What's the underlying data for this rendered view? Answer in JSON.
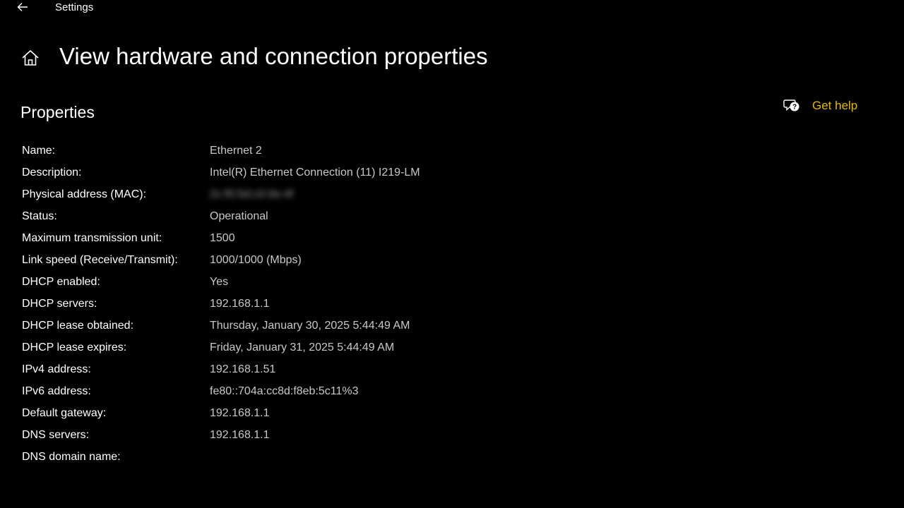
{
  "titlebar": {
    "app_title": "Settings"
  },
  "header": {
    "title": "View hardware and connection properties"
  },
  "section": {
    "title": "Properties"
  },
  "help": {
    "label": "Get help"
  },
  "colors": {
    "background": "#000000",
    "text": "#ffffff",
    "value_text": "#c8c8c8",
    "accent_link": "#e6b800"
  },
  "properties": [
    {
      "label": "Name:",
      "value": "Ethernet 2"
    },
    {
      "label": "Description:",
      "value": "Intel(R) Ethernet Connection (11) I219-LM"
    },
    {
      "label": "Physical address (MAC):",
      "value": "2c:f0:5d:c0:9e:4f"
    },
    {
      "label": "Status:",
      "value": "Operational"
    },
    {
      "label": "Maximum transmission unit:",
      "value": "1500"
    },
    {
      "label": "Link speed (Receive/Transmit):",
      "value": "1000/1000 (Mbps)"
    },
    {
      "label": "DHCP enabled:",
      "value": "Yes"
    },
    {
      "label": "DHCP servers:",
      "value": "192.168.1.1"
    },
    {
      "label": "DHCP lease obtained:",
      "value": "Thursday, January 30, 2025 5:44:49 AM"
    },
    {
      "label": "DHCP lease expires:",
      "value": "Friday, January 31, 2025 5:44:49 AM"
    },
    {
      "label": "IPv4 address:",
      "value": "192.168.1.51"
    },
    {
      "label": "IPv6 address:",
      "value": "fe80::704a:cc8d:f8eb:5c11%3"
    },
    {
      "label": "Default gateway:",
      "value": "192.168.1.1"
    },
    {
      "label": "DNS servers:",
      "value": "192.168.1.1"
    },
    {
      "label": "DNS domain name:",
      "value": ""
    }
  ]
}
